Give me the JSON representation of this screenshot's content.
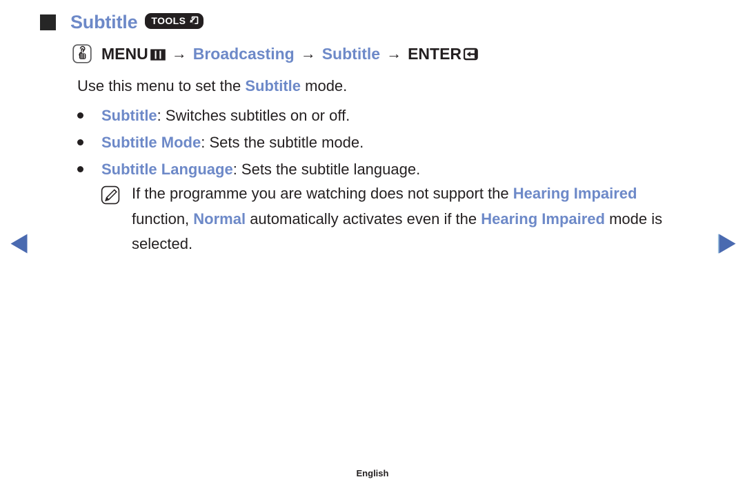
{
  "colors": {
    "accent_blue": "#6d89c8",
    "text_dark": "#231f20",
    "badge_bg": "#231f20",
    "page_bg": "#ffffff"
  },
  "section": {
    "bullet_icon": "square-bullet-icon",
    "title": "Subtitle",
    "tools_badge": {
      "label": "TOOLS",
      "icon": "tools-shortcut-icon"
    }
  },
  "menu_path": {
    "key_icon": "remote-key-press-icon",
    "steps": [
      {
        "label": "MENU",
        "style": "dark",
        "glyph": "menu-grid-icon"
      },
      {
        "label": "Broadcasting",
        "style": "blue",
        "glyph": ""
      },
      {
        "label": "Subtitle",
        "style": "blue",
        "glyph": ""
      },
      {
        "label": "ENTER",
        "style": "dark",
        "glyph": "enter-return-icon"
      }
    ],
    "separator": "→"
  },
  "intro": {
    "before": "Use this menu to set the ",
    "keyword": "Subtitle",
    "after": " mode."
  },
  "bullets": [
    {
      "keyword": "Subtitle",
      "rest": ": Switches subtitles on or off."
    },
    {
      "keyword": "Subtitle Mode",
      "rest": ": Sets the subtitle mode."
    },
    {
      "keyword": "Subtitle Language",
      "rest": ": Sets the subtitle language."
    }
  ],
  "note": {
    "icon": "note-pencil-icon",
    "segments": [
      {
        "text": "If the programme you are watching does not support the ",
        "style": "plain"
      },
      {
        "text": "Hearing Impaired",
        "style": "keyword"
      },
      {
        "text": " function, ",
        "style": "plain"
      },
      {
        "text": "Normal",
        "style": "keyword"
      },
      {
        "text": " automatically activates even if the ",
        "style": "plain"
      },
      {
        "text": "Hearing Impaired",
        "style": "keyword"
      },
      {
        "text": " mode is selected.",
        "style": "plain"
      }
    ]
  },
  "navigation": {
    "previous_icon": "previous-page-arrow-icon",
    "next_icon": "next-page-arrow-icon"
  },
  "footer": {
    "language": "English"
  }
}
